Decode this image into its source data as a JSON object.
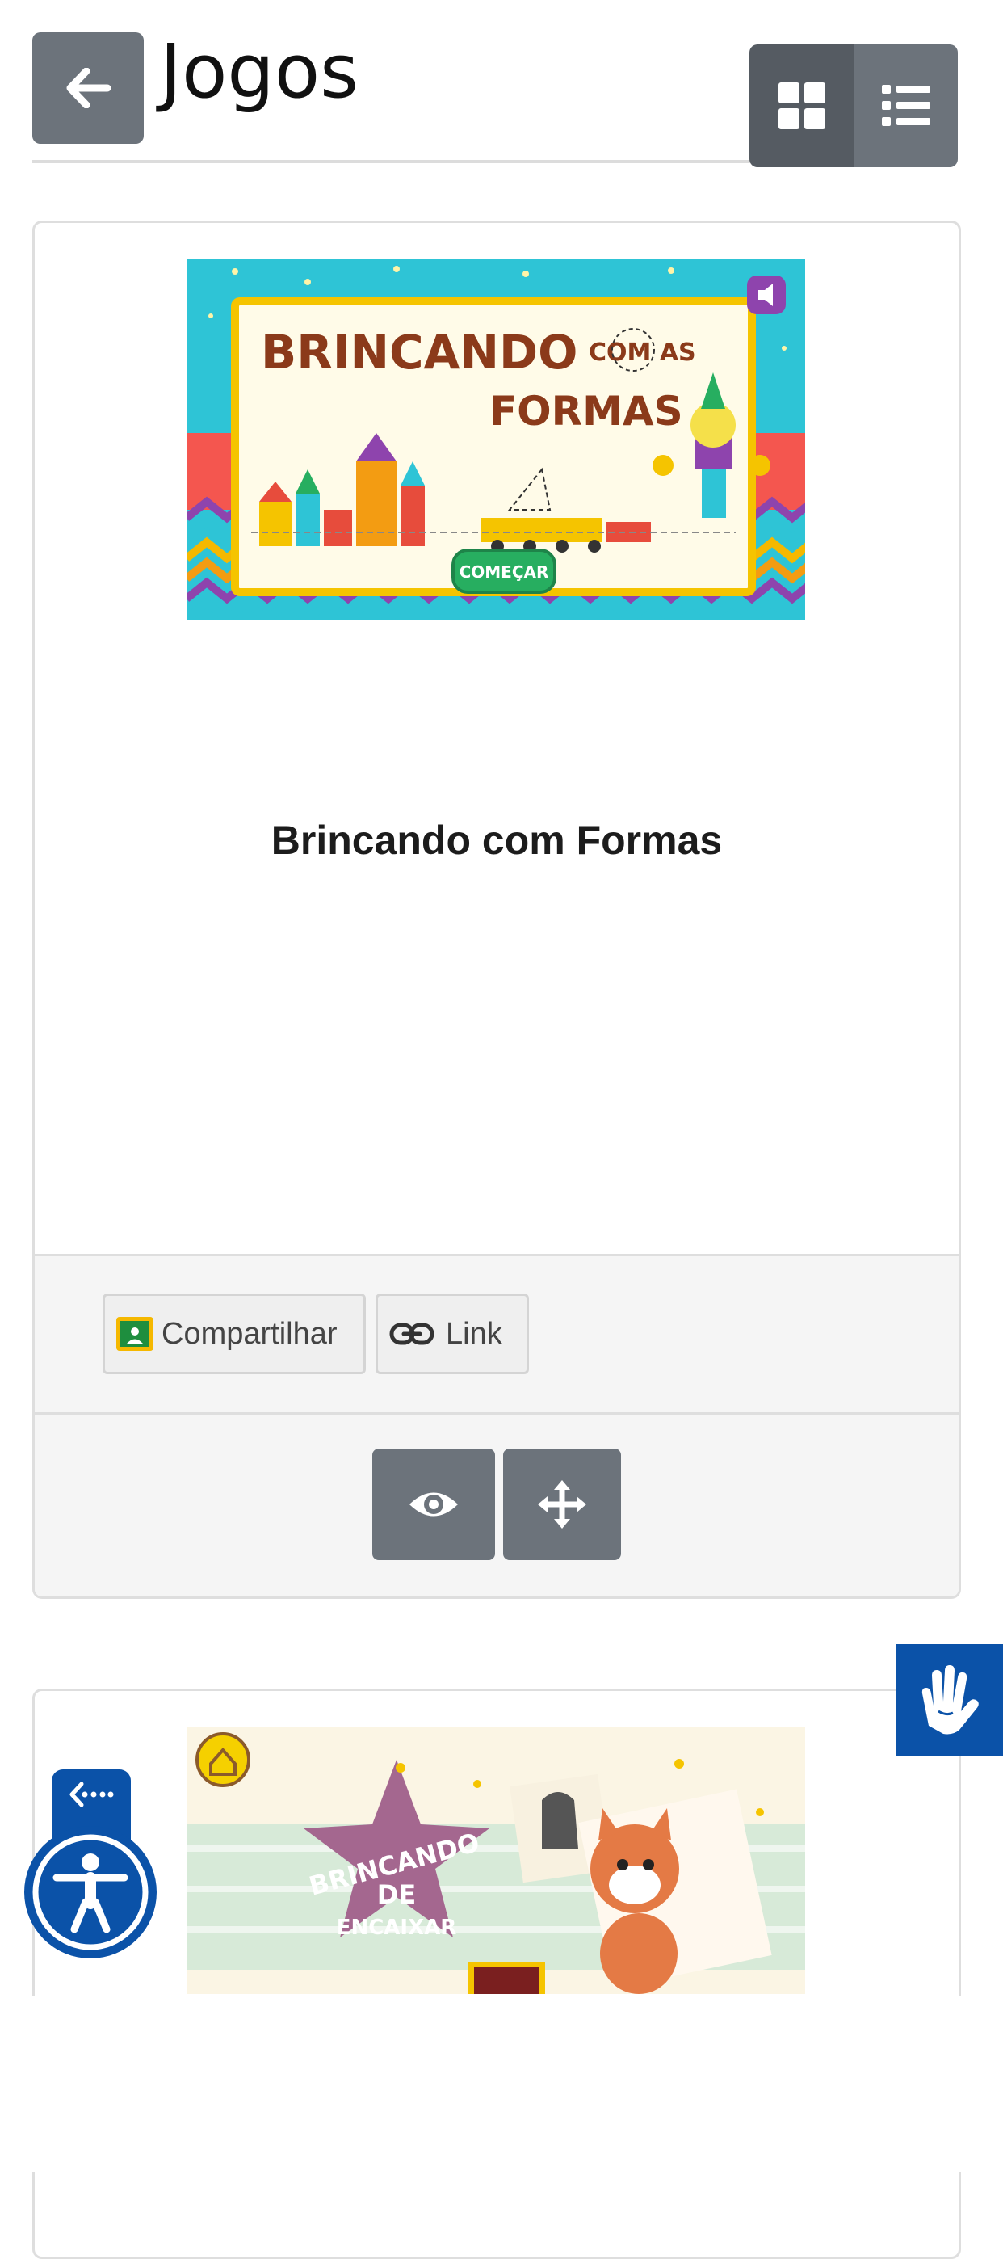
{
  "header": {
    "title": "Jogos",
    "back_icon": "arrow-left-icon",
    "view_grid_icon": "grid-icon",
    "view_list_icon": "list-icon"
  },
  "games": [
    {
      "title": "Brincando com Formas",
      "thumbnail": {
        "line1": "BRINCANDO",
        "line2": "COM AS",
        "line3": "FORMAS",
        "start_label": "COMEÇAR"
      },
      "share": {
        "compartilhar_label": "Compartilhar",
        "link_label": "Link"
      },
      "actions": {
        "view_icon": "eye-icon",
        "move_icon": "move-icon"
      }
    },
    {
      "thumbnail": {
        "line1": "BRINCANDO",
        "line2": "DE",
        "line3": "ENCAIXAR"
      }
    }
  ],
  "colors": {
    "button_gray": "#6c737b",
    "accessibility_blue": "#0b52a8",
    "banner_cyan": "#2ec4d6",
    "banner_brown": "#8b3a1a"
  }
}
